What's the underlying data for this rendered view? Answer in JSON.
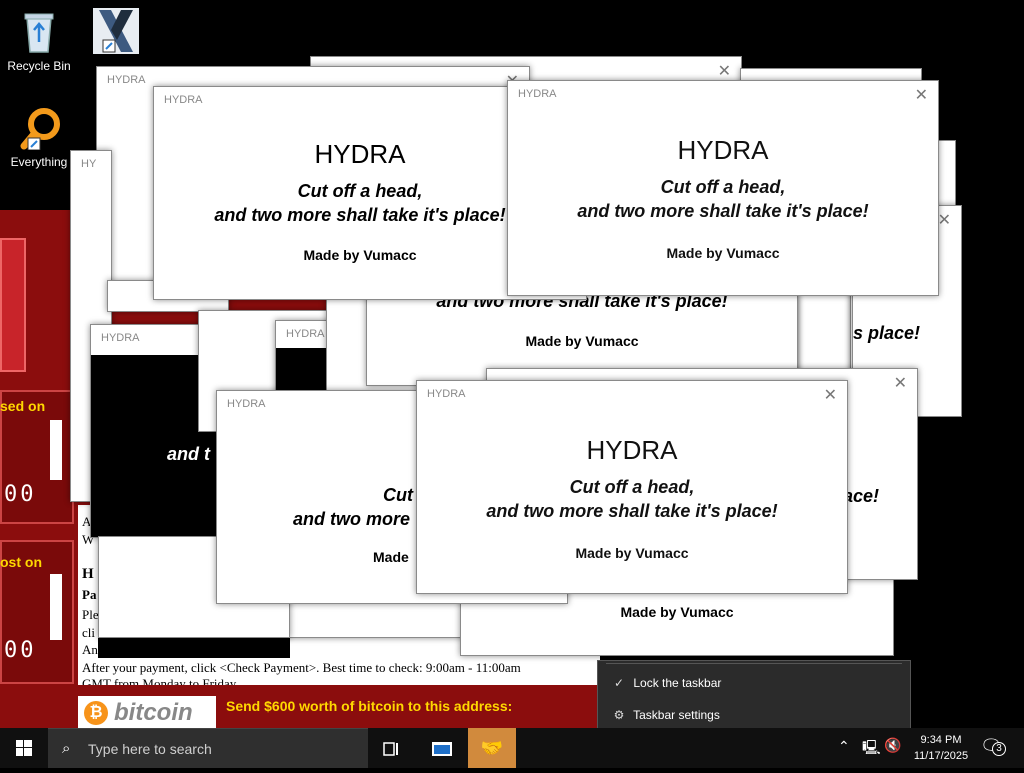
{
  "desktop": {
    "icons": [
      {
        "label": "Recycle Bin",
        "icon": "recycle-bin-icon"
      },
      {
        "label": "",
        "icon": "media-player-icon"
      },
      {
        "label": "Everything",
        "icon": "everything-search-icon"
      }
    ]
  },
  "ransom_window": {
    "lines": [
      "sed on",
      "ost on"
    ],
    "timer_digits": [
      "00",
      "00"
    ],
    "bitcoin_logo": "bitcoin",
    "send_text": "Send $600 worth of bitcoin to this address:",
    "body_fragments": [
      "A",
      "W",
      "H",
      "Pa",
      "Ple",
      "cli",
      "An"
    ],
    "payment_line": "After your payment, click <Check Payment>. Best time to check: 9:00am - 11:00am",
    "gmt_line": "GMT from Monday to Friday."
  },
  "hydra_popup": {
    "title": "HYDRA",
    "heading": "HYDRA",
    "line1": "Cut off a head,",
    "line2": "and two more shall take it's place!",
    "credit": "Made by Vumacc",
    "close_icon": "close-icon"
  },
  "fragments": {
    "f1": "and two more shall take it's place!",
    "f2": "Made by Vumacc",
    "f3": "s place!",
    "f4": "and t",
    "f5": "ace!",
    "f6": "Made by Vumacc",
    "f7": "Cut",
    "f8": "and two more",
    "f9": "an",
    "f10": "Made",
    "f11": "a"
  },
  "context_menu": {
    "items": [
      {
        "label": "Lock the taskbar",
        "icon": "checkmark-icon"
      },
      {
        "label": "Taskbar settings",
        "icon": "gear-icon"
      }
    ]
  },
  "taskbar": {
    "search_placeholder": "Type here to search",
    "time": "9:34 PM",
    "date": "11/17/2025",
    "notification_count": "3"
  }
}
